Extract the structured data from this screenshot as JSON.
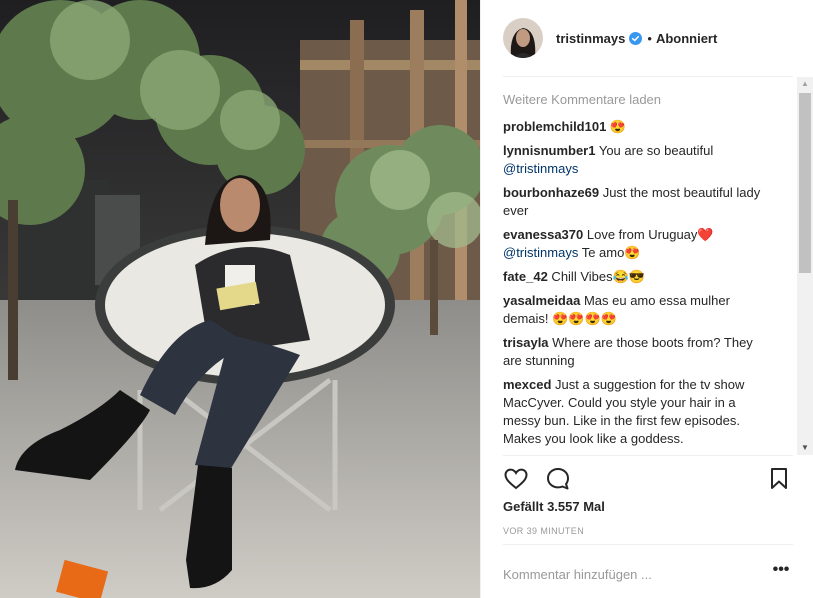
{
  "post": {
    "username": "tristinmays",
    "follow_state": "Abonniert",
    "separator": "•",
    "verified_icon": "verified-badge-icon"
  },
  "comments": {
    "load_more": "Weitere Kommentare laden",
    "items": [
      {
        "user": "problemchild101",
        "text": " 😍",
        "mention": "",
        "after": ""
      },
      {
        "user": "lynnisnumber1",
        "text": " You are so beautiful ",
        "mention": "@tristinmays",
        "after": ""
      },
      {
        "user": "bourbonhaze69",
        "text": " Just the most beautiful lady ever",
        "mention": "",
        "after": ""
      },
      {
        "user": "evanessa370",
        "text": " Love from Uruguay❤️ ",
        "mention": "@tristinmays",
        "after": " Te amo😍"
      },
      {
        "user": "fate_42",
        "text": " Chill Vibes😂😎",
        "mention": "",
        "after": ""
      },
      {
        "user": "yasalmeidaa",
        "text": " Mas eu amo essa mulher demais! 😍😍😍😍",
        "mention": "",
        "after": ""
      },
      {
        "user": "trisayla",
        "text": " Where are those boots from? They are stunning",
        "mention": "",
        "after": ""
      },
      {
        "user": "mexced",
        "text": " Just a suggestion for the tv show MacCyver. Could you style your hair in a messy bun. Like in the first few episodes. Makes you look like a goddess.",
        "mention": "",
        "after": ""
      }
    ]
  },
  "actions": {
    "like_icon": "heart-icon",
    "comment_icon": "comment-icon",
    "save_icon": "bookmark-icon"
  },
  "likes": "Gefällt 3.557 Mal",
  "timestamp": "VOR 39 MINUTEN",
  "add_comment": {
    "placeholder": "Kommentar hinzufügen ...",
    "more_label": "•••"
  },
  "scrollbar": {
    "up_arrow": "▲",
    "down_arrow": "▼"
  },
  "colors": {
    "mention": "#003569",
    "muted": "#999999",
    "text": "#262626",
    "verified": "#3897f0"
  }
}
